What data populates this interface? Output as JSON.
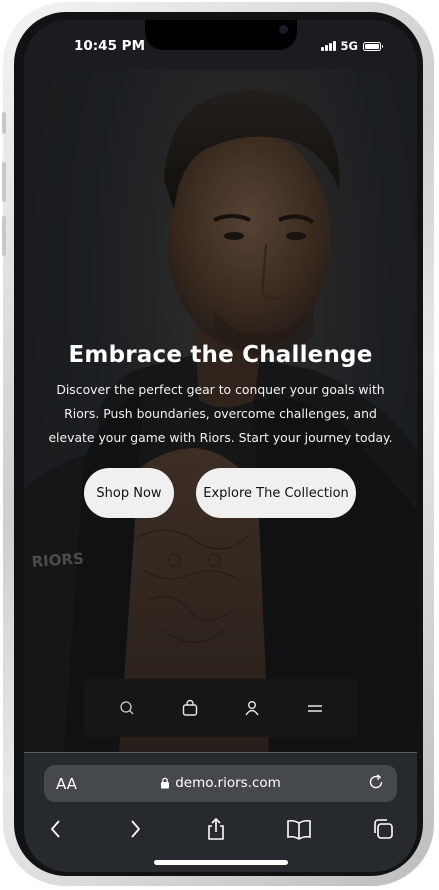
{
  "status_bar": {
    "time": "10:45 PM",
    "network": "5G"
  },
  "hero": {
    "title": "Embrace the Challenge",
    "description": "Discover the perfect gear to conquer your goals with Riors. Push boundaries, overcome challenges, and elevate your game with Riors. Start your journey today.",
    "buttons": {
      "shop_now": "Shop Now",
      "explore": "Explore The Collection"
    },
    "jacket_logo": "RIORS"
  },
  "bottom_nav": {
    "items": [
      {
        "icon": "search-icon"
      },
      {
        "icon": "shopping-bag-icon"
      },
      {
        "icon": "user-icon"
      },
      {
        "icon": "menu-icon"
      }
    ]
  },
  "browser": {
    "text_size_label": "AA",
    "url": "demo.riors.com",
    "toolbar": [
      "back-icon",
      "forward-icon",
      "share-icon",
      "bookmarks-icon",
      "tabs-icon"
    ]
  },
  "colors": {
    "background": "#1e2124",
    "button_bg": "#f0f0f0",
    "nav_bg": "#141618",
    "browser_bar": "#26292d"
  }
}
